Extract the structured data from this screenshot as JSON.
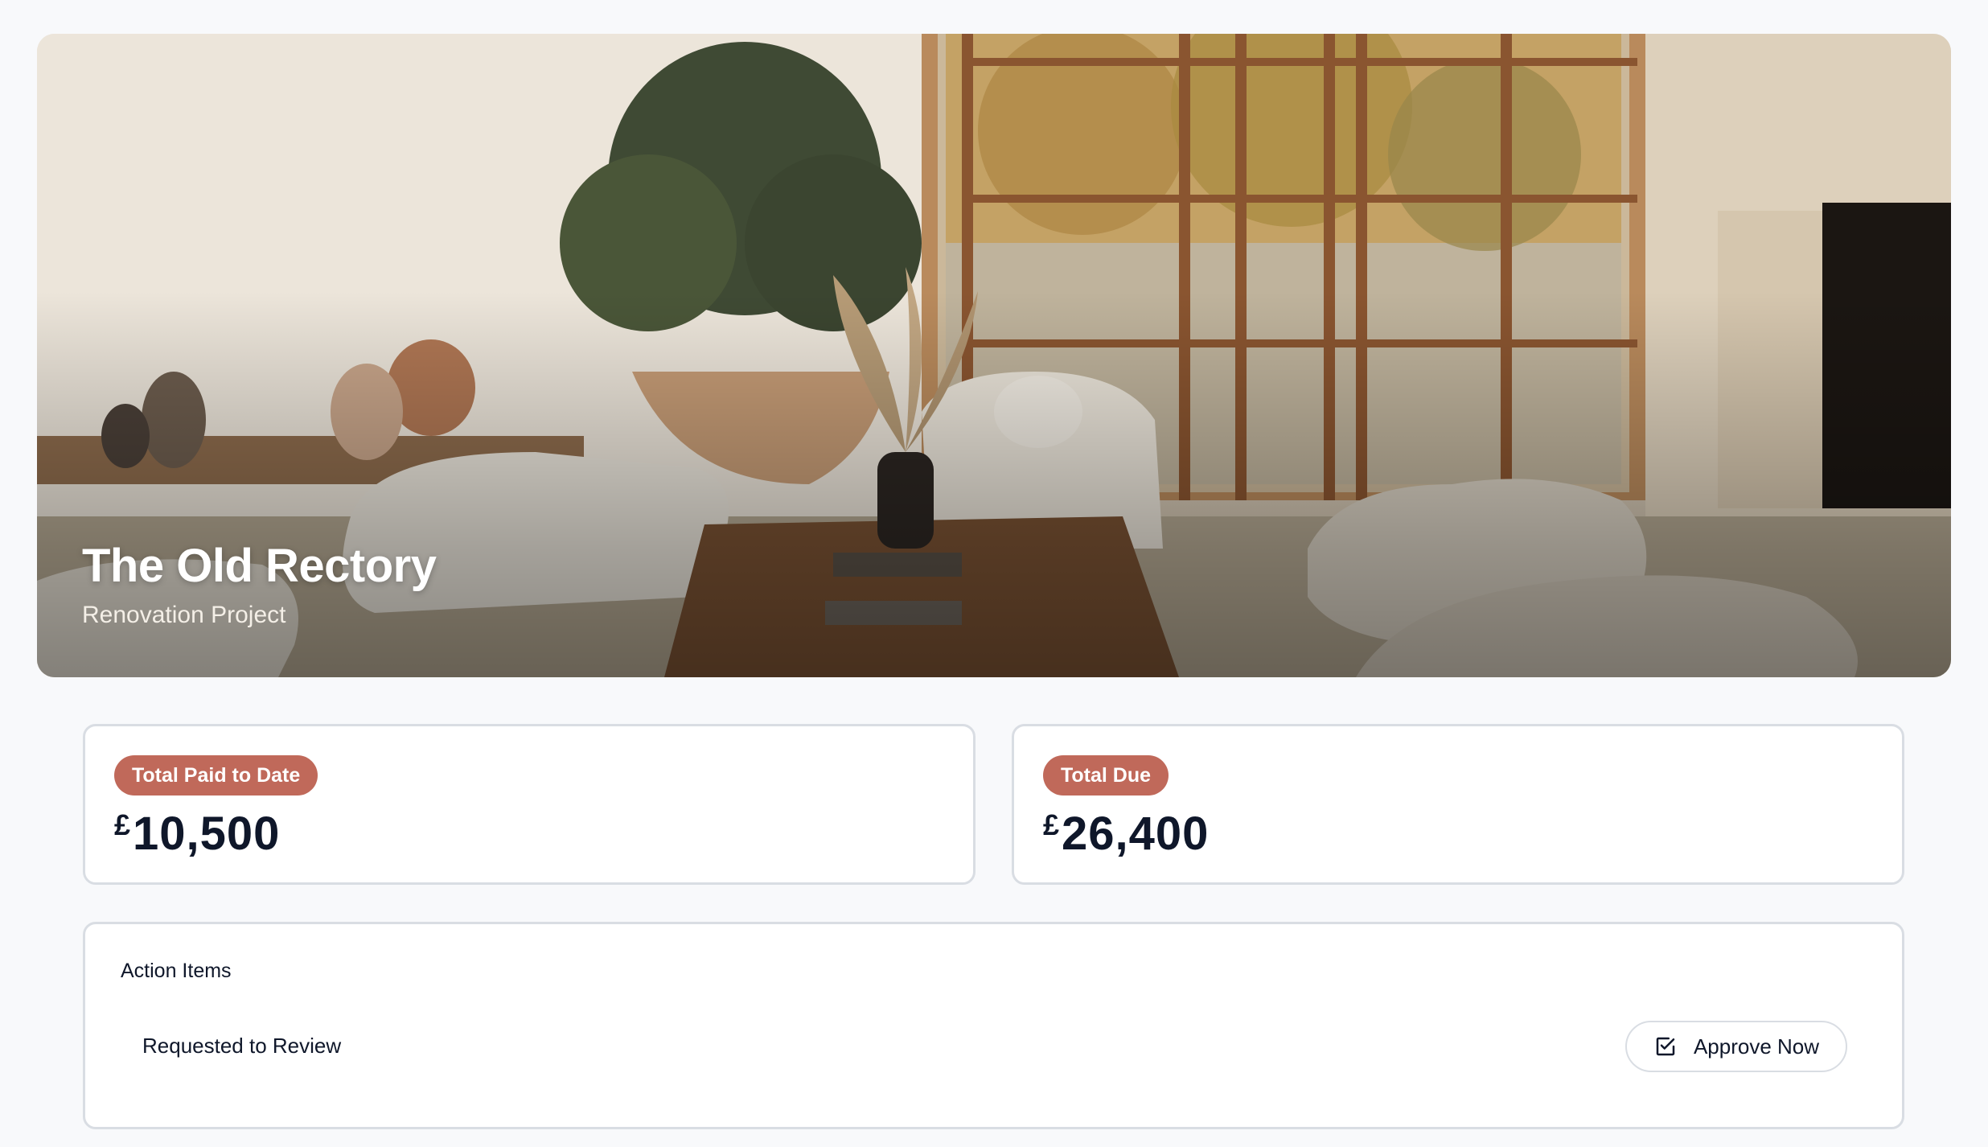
{
  "hero": {
    "title": "The Old Rectory",
    "subtitle": "Renovation Project"
  },
  "stats": {
    "paid": {
      "label": "Total Paid to Date",
      "currency": "£",
      "amount": "10,500"
    },
    "due": {
      "label": "Total Due",
      "currency": "£",
      "amount": "26,400"
    }
  },
  "actions": {
    "title": "Action Items",
    "items": [
      {
        "label": "Requested to Review",
        "button_label": "Approve Now",
        "button_icon": "checkbox-check-icon"
      }
    ]
  },
  "colors": {
    "badge": "#c0695a",
    "text": "#0f172a",
    "border": "#d9dde3",
    "background": "#f8f9fb"
  }
}
